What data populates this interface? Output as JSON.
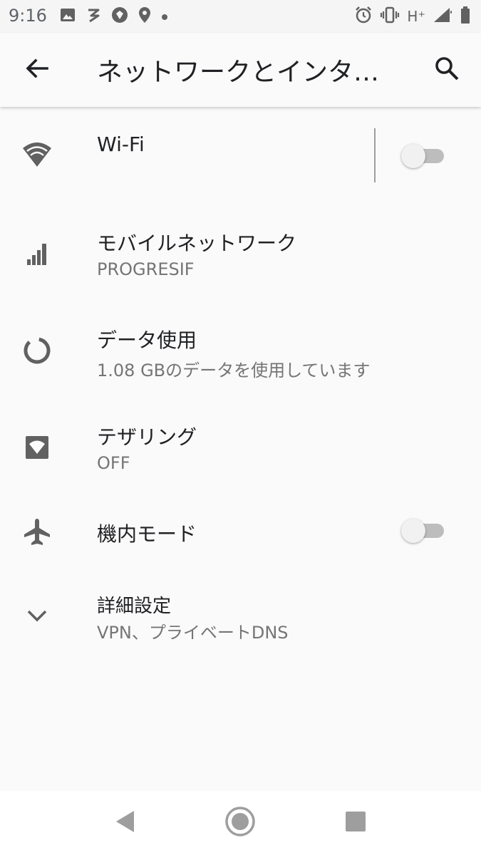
{
  "status_bar": {
    "time": "9:16",
    "network_type": "H⁺",
    "left_icons": [
      "image-icon",
      "cast-icon",
      "app-icon",
      "location-icon",
      "dot-icon"
    ],
    "right_icons": [
      "alarm-icon",
      "vibrate-icon",
      "signal-icon",
      "battery-icon"
    ]
  },
  "app_bar": {
    "title": "ネットワークとインターネット",
    "back_icon": "back-arrow-icon",
    "search_icon": "search-icon"
  },
  "items": [
    {
      "title": "Wi-Fi",
      "subtitle": "",
      "icon": "wifi-icon",
      "toggle": false
    },
    {
      "title": "モバイルネットワーク",
      "subtitle": "PROGRESIF",
      "icon": "cell-signal-icon"
    },
    {
      "title": "データ使用",
      "subtitle": "1.08 GBのデータを使用しています",
      "icon": "data-usage-icon"
    },
    {
      "title": "テザリング",
      "subtitle": "OFF",
      "icon": "hotspot-icon"
    },
    {
      "title": "機内モード",
      "subtitle": "",
      "icon": "airplane-icon",
      "toggle": false
    },
    {
      "title": "詳細設定",
      "subtitle": "VPN、プライベートDNS",
      "icon": "chevron-down-icon"
    }
  ],
  "nav_bar": {
    "buttons": [
      "back-triangle-icon",
      "home-circle-icon",
      "recents-square-icon"
    ]
  },
  "colors": {
    "background": "#fafafa",
    "icon": "#616161",
    "title_text": "#202124",
    "subtitle_text": "#757575",
    "toggle_track_off": "#bdbdbd",
    "toggle_thumb_off": "#f1f1f1"
  }
}
